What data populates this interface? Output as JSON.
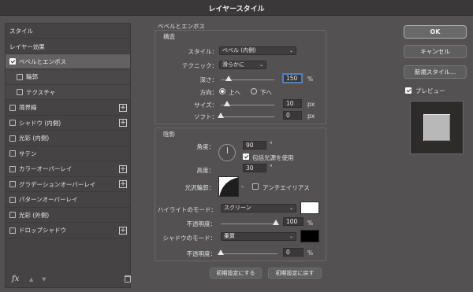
{
  "title": "レイヤースタイル",
  "left": {
    "style_header": "スタイル",
    "layer_effects": "レイヤー効果",
    "items": [
      {
        "label": "ベベルとエンボス",
        "checked": true,
        "selected": true,
        "plus": false
      },
      {
        "label": "輪郭",
        "checked": false,
        "sub": true
      },
      {
        "label": "テクスチャ",
        "checked": false,
        "sub": true
      },
      {
        "label": "境界線",
        "checked": false,
        "plus": true
      },
      {
        "label": "シャドウ (内側)",
        "checked": false,
        "plus": true
      },
      {
        "label": "光彩 (内側)",
        "checked": false,
        "plus": false
      },
      {
        "label": "サテン",
        "checked": false,
        "plus": false
      },
      {
        "label": "カラーオーバーレイ",
        "checked": false,
        "plus": true
      },
      {
        "label": "グラデーションオーバーレイ",
        "checked": false,
        "plus": true
      },
      {
        "label": "パターンオーバーレイ",
        "checked": false,
        "plus": false
      },
      {
        "label": "光彩 (外側)",
        "checked": false,
        "plus": false
      },
      {
        "label": "ドロップシャドウ",
        "checked": false,
        "plus": true
      }
    ],
    "fx": "fx"
  },
  "bevel": {
    "section_title": "ベベルとエンボス",
    "structure_title": "構造",
    "style_label": "スタイル：",
    "style_value": "ベベル (内側)",
    "technique_label": "テクニック：",
    "technique_value": "滑らかに",
    "depth_label": "深さ：",
    "depth_value": "150",
    "depth_unit": "%",
    "direction_label": "方向：",
    "dir_up": "上へ",
    "dir_down": "下へ",
    "size_label": "サイズ：",
    "size_value": "10",
    "size_unit": "px",
    "soften_label": "ソフト：",
    "soften_value": "0",
    "soften_unit": "px"
  },
  "shading": {
    "title": "陰影",
    "angle_label": "角度：",
    "angle_value": "90",
    "degree": "°",
    "global_light": "包括光源を使用",
    "altitude_label": "高度：",
    "altitude_value": "30",
    "gloss_label": "光沢輪郭：",
    "anti_alias": "アンチエイリアス",
    "highlight_mode_label": "ハイライトのモード：",
    "highlight_mode": "スクリーン",
    "highlight_opacity_label": "不透明度：",
    "highlight_opacity": "100",
    "shadow_mode_label": "シャドウのモード：",
    "shadow_mode": "乗算",
    "shadow_opacity_label": "不透明度：",
    "shadow_opacity": "0",
    "percent": "%",
    "highlight_color": "#ffffff",
    "shadow_color": "#000000"
  },
  "buttons": {
    "make_default": "初期設定にする",
    "reset_default": "初期設定に戻す",
    "ok": "OK",
    "cancel": "キャンセル",
    "new_style": "新規スタイル...",
    "preview": "プレビュー"
  }
}
